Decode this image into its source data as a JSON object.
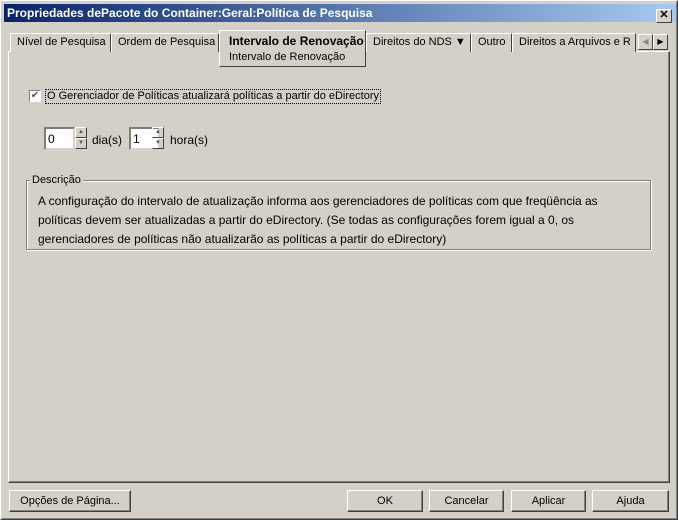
{
  "window": {
    "title": "Propriedades dePacote do Container:Geral:Política de Pesquisa",
    "close": "✕"
  },
  "tabs": [
    {
      "label": "Nível de Pesquisa"
    },
    {
      "label": "Ordem de Pesquisa"
    },
    {
      "label": "Intervalo de Renovação",
      "sublabel": "Intervalo de Renovação",
      "selected": true
    },
    {
      "label": "Direitos do NDS ▼"
    },
    {
      "label": "Outro"
    },
    {
      "label": "Direitos a Arquivos e R"
    }
  ],
  "scroll": {
    "left": "◀",
    "right": "▶"
  },
  "checkbox": {
    "label": "O Gerenciador de Políticas atualizará políticas a partir do eDirectory",
    "checked": true,
    "mark": "✔"
  },
  "days": {
    "value": "0",
    "label": "dia(s)"
  },
  "hours": {
    "value": "1",
    "label": "hora(s)"
  },
  "spin": {
    "up": "▲",
    "down": "▼"
  },
  "description": {
    "title": "Descrição",
    "text": "A configuração do intervalo de atualização informa aos gerenciadores de políticas com que freqüência as políticas devem ser atualizadas a partir do eDirectory. (Se todas as configurações forem igual a 0, os gerenciadores de políticas não atualizarão as políticas a partir do eDirectory)"
  },
  "buttons": {
    "page_options": "Opções de Página...",
    "ok": "OK",
    "cancel": "Cancelar",
    "apply": "Aplicar",
    "help": "Ajuda"
  }
}
